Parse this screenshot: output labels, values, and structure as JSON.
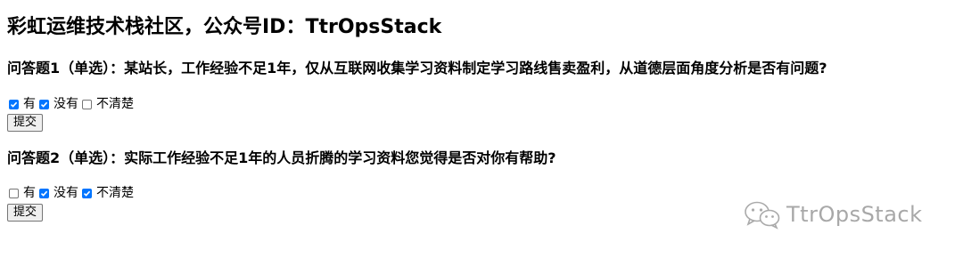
{
  "title": "彩虹运维技术栈社区，公众号ID：TtrOpsStack",
  "questions": [
    {
      "text": "问答题1（单选）：某站长，工作经验不足1年，仅从互联网收集学习资料制定学习路线售卖盈利，从道德层面角度分析是否有问题?",
      "options": [
        {
          "label": "有",
          "checked": true
        },
        {
          "label": "没有",
          "checked": true
        },
        {
          "label": "不清楚",
          "checked": false
        }
      ],
      "submit_label": "提交"
    },
    {
      "text": "问答题2（单选）：实际工作经验不足1年的人员折腾的学习资料您觉得是否对你有帮助?",
      "options": [
        {
          "label": "有",
          "checked": false
        },
        {
          "label": "没有",
          "checked": true
        },
        {
          "label": "不清楚",
          "checked": true
        }
      ],
      "submit_label": "提交"
    }
  ],
  "watermark": {
    "text": "TtrOpsStack",
    "icon": "wechat-icon"
  },
  "colors": {
    "checkbox_checked": "#0075ff",
    "watermark": "#a8a8a8"
  }
}
